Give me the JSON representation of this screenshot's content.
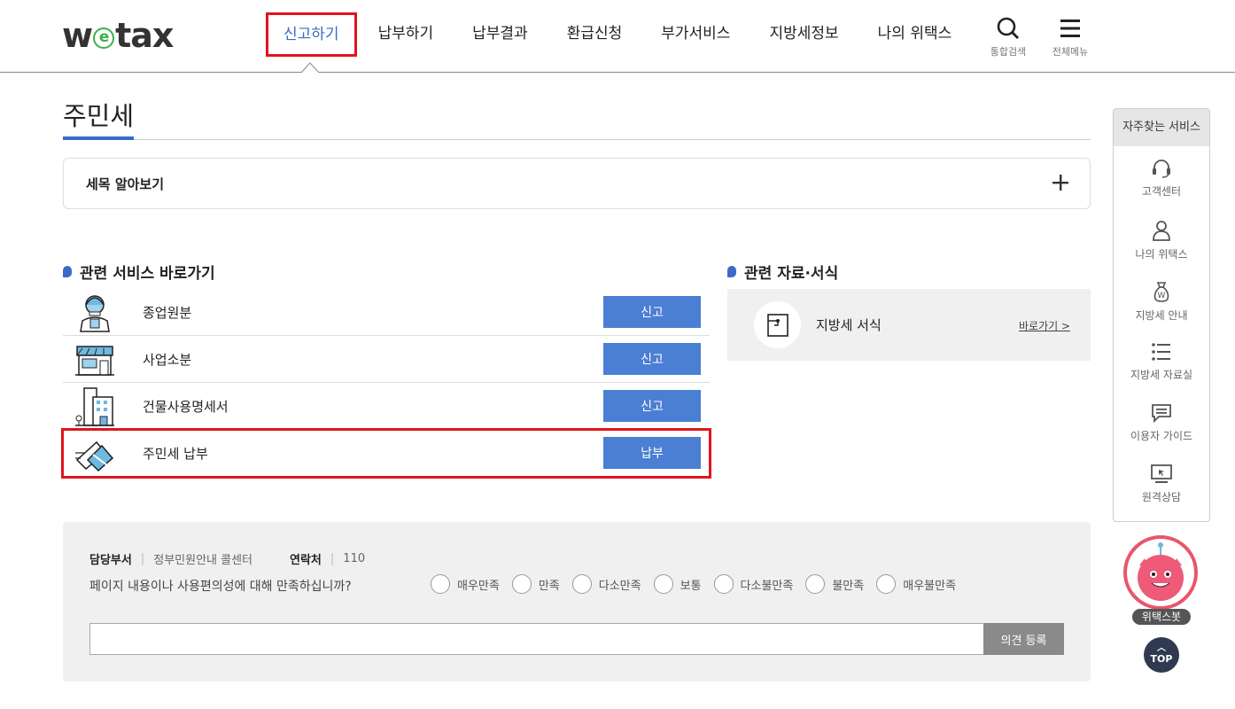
{
  "header": {
    "logo": {
      "w": "w",
      "e": "e",
      "tax": "tax"
    },
    "nav": [
      {
        "label": "신고하기",
        "active": true
      },
      {
        "label": "납부하기"
      },
      {
        "label": "납부결과"
      },
      {
        "label": "환급신청"
      },
      {
        "label": "부가서비스"
      },
      {
        "label": "지방세정보"
      },
      {
        "label": "나의 위택스"
      }
    ],
    "search_label": "통합검색",
    "menu_label": "전체메뉴"
  },
  "page": {
    "title": "주민세",
    "accordion_label": "세목 알아보기"
  },
  "services": {
    "title": "관련 서비스 바로가기",
    "items": [
      {
        "label": "종업원분",
        "button": "신고",
        "icon": "employee-icon"
      },
      {
        "label": "사업소분",
        "button": "신고",
        "icon": "store-icon"
      },
      {
        "label": "건물사용명세서",
        "button": "신고",
        "icon": "building-icon"
      },
      {
        "label": "주민세 납부",
        "button": "납부",
        "icon": "card-payment-icon"
      }
    ]
  },
  "resources": {
    "title": "관련 자료·서식",
    "item_label": "지방세 서식",
    "link": "바로가기 >"
  },
  "survey": {
    "dept_label": "담당부서",
    "dept_value": "정부민원안내 콜센터",
    "contact_label": "연락처",
    "contact_value": "110",
    "question": "페이지 내용이나 사용편의성에 대해 만족하십니까?",
    "options": [
      "매우만족",
      "만족",
      "다소만족",
      "보통",
      "다소불만족",
      "불만족",
      "매우불만족"
    ],
    "submit": "의견 등록"
  },
  "quick_menu": {
    "title": "자주찾는 서비스",
    "items": [
      {
        "label": "고객센터",
        "icon": "headset-icon"
      },
      {
        "label": "나의 위택스",
        "icon": "person-icon"
      },
      {
        "label": "지방세 안내",
        "icon": "money-bag-icon"
      },
      {
        "label": "지방세 자료실",
        "icon": "list-icon"
      },
      {
        "label": "이용자 가이드",
        "icon": "chat-icon"
      },
      {
        "label": "원격상담",
        "icon": "monitor-icon"
      }
    ]
  },
  "bot_label": "위택스봇",
  "top_label": "TOP",
  "colors": {
    "accent": "#3a6bc7",
    "button": "#4a7fd3",
    "highlight": "#e0141e",
    "logo_e": "#3fae4a"
  }
}
